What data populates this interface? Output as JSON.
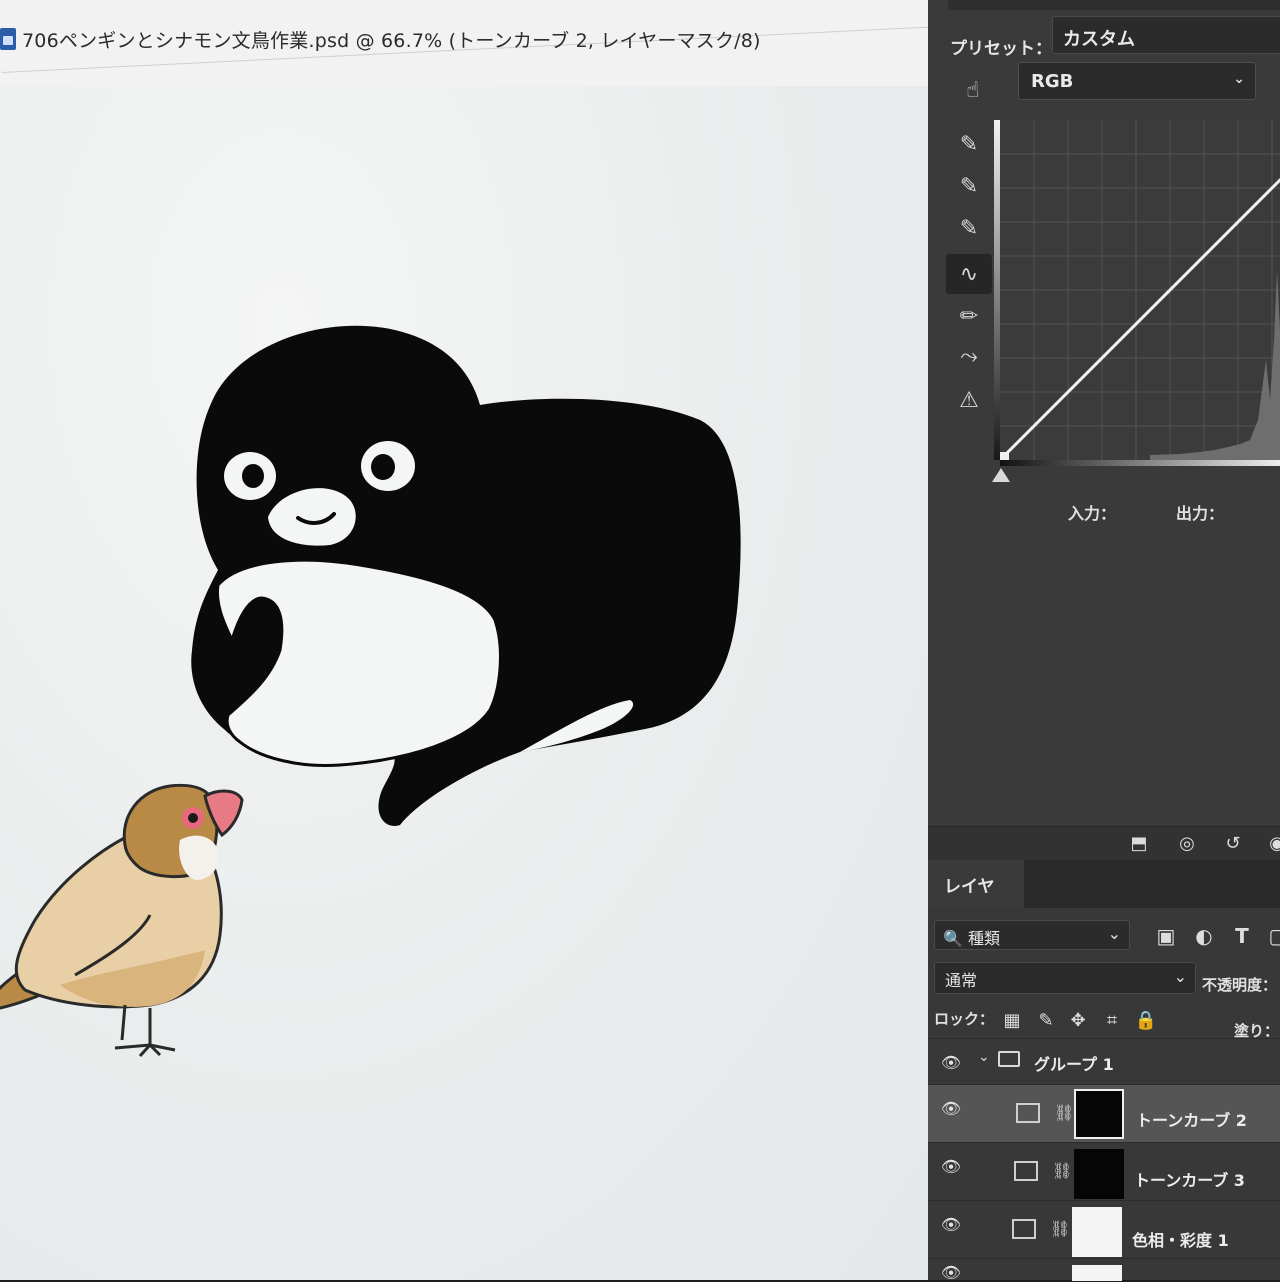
{
  "document": {
    "tab_title": "706ペンギンとシナモン文鳥作業.psd @ 66.7% (トーンカーブ 2, レイヤーマスク/8)"
  },
  "properties": {
    "preset_label": "プリセット：",
    "preset_value": "カスタム",
    "channel_value": "RGB",
    "input_label": "入力：",
    "output_label": "出力："
  },
  "layers": {
    "tab_label": "レイヤー",
    "filter_value": "種類",
    "blend_mode": "通常",
    "opacity_label": "不透明度：",
    "lock_label": "ロック：",
    "fill_label": "塗り：",
    "items": [
      {
        "name": "グループ 1"
      },
      {
        "name": "トーンカーブ 2"
      },
      {
        "name": "トーンカーブ 3"
      },
      {
        "name": "色相・彩度 1"
      }
    ]
  },
  "colors": {
    "panel_bg": "#383838",
    "canvas_bg": "#eef0f0",
    "penguin": "#0a0a0a",
    "bird_body": "#e9cfa6",
    "bird_head": "#b88a45",
    "bird_beak": "#e87a86"
  }
}
